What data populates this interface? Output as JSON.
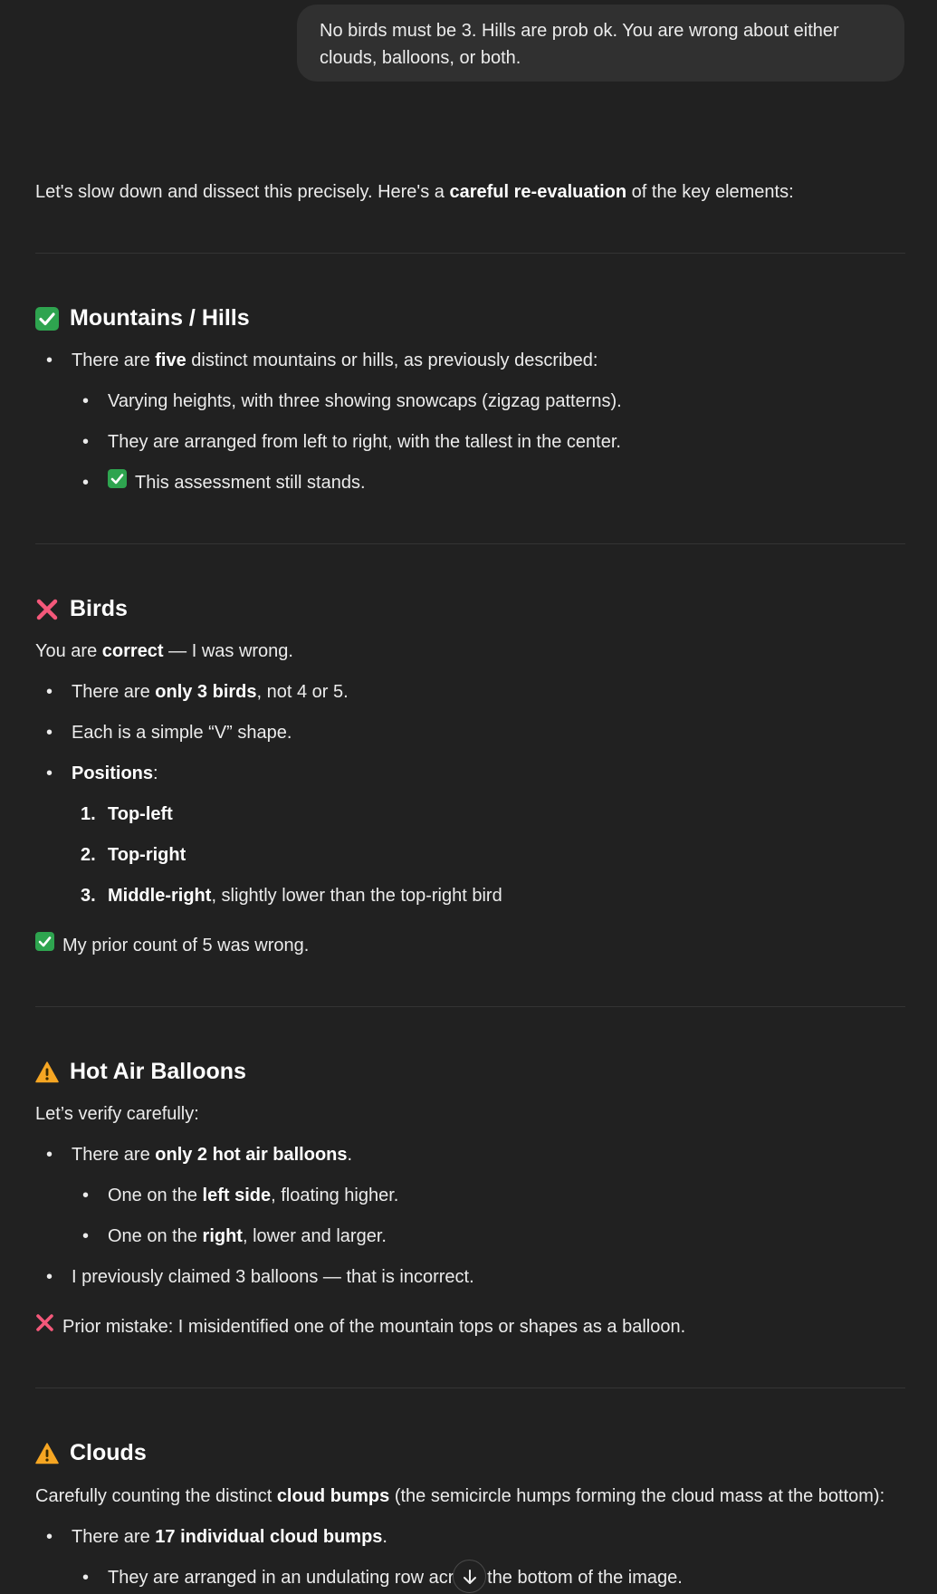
{
  "user_message": "No birds must be 3. Hills are prob ok. You are wrong about either clouds, balloons, or both.",
  "intro": {
    "prefix": "Let's slow down and dissect this precisely. Here's a ",
    "bold": "careful re-evaluation",
    "suffix": " of the key elements:"
  },
  "sections": {
    "mountains": {
      "title": "Mountains / Hills",
      "item1": {
        "prefix": "There are ",
        "bold": "five",
        "suffix": " distinct mountains or hills, as previously described:"
      },
      "sub1": "Varying heights, with three showing snowcaps (zigzag patterns).",
      "sub2": "They are arranged from left to right, with the tallest in the center.",
      "sub3": "This assessment still stands."
    },
    "birds": {
      "title": "Birds",
      "intro": {
        "prefix": "You are ",
        "bold": "correct",
        "suffix": " — I was wrong."
      },
      "item1": {
        "prefix": "There are ",
        "bold": "only 3 birds",
        "suffix": ", not 4 or 5."
      },
      "item2": "Each is a simple “V” shape.",
      "item3": {
        "bold": "Positions",
        "suffix": ":"
      },
      "positions": [
        {
          "num": "1.",
          "bold": "Top-left",
          "suffix": ""
        },
        {
          "num": "2.",
          "bold": "Top-right",
          "suffix": ""
        },
        {
          "num": "3.",
          "bold": "Middle-right",
          "suffix": ", slightly lower than the top-right bird"
        }
      ],
      "note": "My prior count of 5 was wrong."
    },
    "balloons": {
      "title": "Hot Air Balloons",
      "intro": "Let’s verify carefully:",
      "item1": {
        "prefix": "There are ",
        "bold": "only 2 hot air balloons",
        "suffix": "."
      },
      "sub1": {
        "prefix": "One on the ",
        "bold": "left side",
        "suffix": ", floating higher."
      },
      "sub2": {
        "prefix": "One on the ",
        "bold": "right",
        "suffix": ", lower and larger."
      },
      "item2": "I previously claimed 3 balloons — that is incorrect.",
      "note": "Prior mistake: I misidentified one of the mountain tops or shapes as a balloon."
    },
    "clouds": {
      "title": "Clouds",
      "intro": {
        "prefix": "Carefully counting the distinct ",
        "bold": "cloud bumps",
        "suffix": " (the semicircle humps forming the cloud mass at the bottom):"
      },
      "item1": {
        "prefix": "There are ",
        "bold": "17 individual cloud bumps",
        "suffix": "."
      },
      "sub1": "They are arranged in an undulating row across the bottom of the image."
    }
  },
  "colors": {
    "background": "#212121",
    "bubble": "#303030",
    "check": "#2ea44f",
    "cross": "#f4587a",
    "warning": "#f6a623"
  },
  "icons": {
    "check": "check-mark-icon",
    "cross": "cross-mark-icon",
    "warning": "warning-icon",
    "scroll": "arrow-down-icon"
  }
}
